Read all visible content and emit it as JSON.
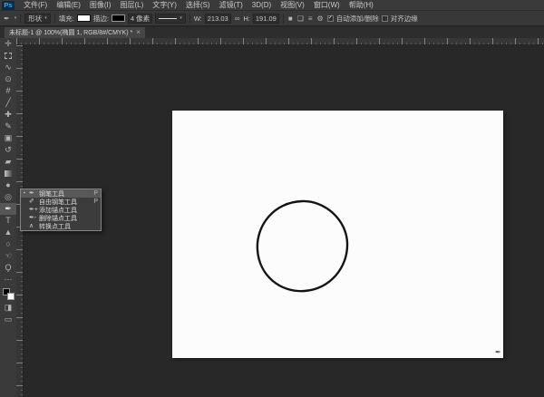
{
  "app": {
    "logo_text": "Ps"
  },
  "menu_bar": {
    "items": [
      "文件(F)",
      "编辑(E)",
      "图像(I)",
      "图层(L)",
      "文字(Y)",
      "选择(S)",
      "滤镜(T)",
      "3D(D)",
      "视图(V)",
      "窗口(W)",
      "帮助(H)"
    ]
  },
  "options_bar": {
    "tool_mode": "形状",
    "fill_label": "填充:",
    "stroke_label": "描边:",
    "stroke_width": "4 像素",
    "w_label": "W:",
    "w_value": "213.03",
    "h_label": "H:",
    "h_value": "191.09",
    "auto_add_delete_label": "自动添加/删除",
    "align_edges_label": "对齐边缘"
  },
  "document_tab": {
    "title": "未标题-1 @ 100%(椭圆 1, RGB/8#/CMYK) *"
  },
  "toolbar": {
    "tools": [
      {
        "name": "move-tool",
        "glyph": "✛"
      },
      {
        "name": "marquee-tool",
        "glyph": ""
      },
      {
        "name": "lasso-tool",
        "glyph": "∿"
      },
      {
        "name": "quick-selection-tool",
        "glyph": "⊙"
      },
      {
        "name": "crop-tool",
        "glyph": "#"
      },
      {
        "name": "eyedropper-tool",
        "glyph": "╱"
      },
      {
        "name": "healing-brush-tool",
        "glyph": "✚"
      },
      {
        "name": "brush-tool",
        "glyph": "✎"
      },
      {
        "name": "clone-stamp-tool",
        "glyph": "▣"
      },
      {
        "name": "history-brush-tool",
        "glyph": "↺"
      },
      {
        "name": "eraser-tool",
        "glyph": "▰"
      },
      {
        "name": "gradient-tool",
        "glyph": ""
      },
      {
        "name": "blur-tool",
        "glyph": "●"
      },
      {
        "name": "dodge-tool",
        "glyph": "◎"
      },
      {
        "name": "pen-tool",
        "glyph": "✒",
        "selected": true
      },
      {
        "name": "type-tool",
        "glyph": "T"
      },
      {
        "name": "path-selection-tool",
        "glyph": "▲"
      },
      {
        "name": "shape-tool",
        "glyph": "○"
      },
      {
        "name": "hand-tool",
        "glyph": "☜"
      },
      {
        "name": "zoom-tool",
        "glyph": "Ϙ"
      },
      {
        "name": "edit-toolbar-button",
        "glyph": "⋯"
      },
      {
        "name": "color-swatches",
        "glyph": ""
      },
      {
        "name": "quick-mask-button",
        "glyph": "◨"
      },
      {
        "name": "screen-mode-button",
        "glyph": "▭"
      }
    ]
  },
  "pen_flyout": {
    "items": [
      {
        "icon": "✒",
        "label": "钢笔工具",
        "shortcut": "P",
        "selected": true
      },
      {
        "icon": "✐",
        "label": "自由钢笔工具",
        "shortcut": "P",
        "selected": false
      },
      {
        "icon": "✒+",
        "label": "添加锚点工具",
        "shortcut": "",
        "selected": false
      },
      {
        "icon": "✒-",
        "label": "删除锚点工具",
        "shortcut": "",
        "selected": false
      },
      {
        "icon": "∧",
        "label": "转换点工具",
        "shortcut": "",
        "selected": false
      }
    ]
  },
  "icons": {
    "caret": "▾",
    "check": "✓",
    "link": "∞",
    "gear": "⚙",
    "close": "×",
    "pen": "✒",
    "path_ops": "■",
    "path_align": "❏",
    "path_arrange": "≡",
    "flyout_marker": "▪"
  },
  "canvas": {
    "shape": "ellipse-outline",
    "stroke_color": "#141414",
    "fill": "none"
  },
  "colors": {
    "menubar_bg": "#3a3a3a",
    "options_bg": "#383838",
    "workarea_bg": "#282828",
    "canvas_bg": "#fcfcfc",
    "tab_bg": "#454545",
    "logo_bg": "#0b2a45",
    "logo_fg": "#3caaf4"
  }
}
